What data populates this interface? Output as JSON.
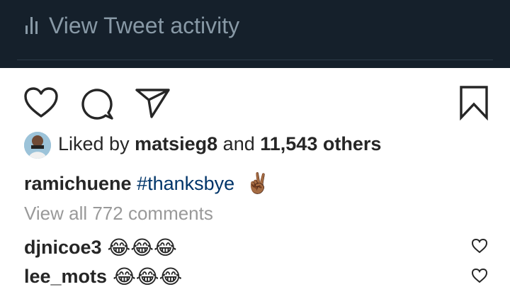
{
  "tweet_activity": {
    "label": "View Tweet activity",
    "icon": "bar-chart-icon"
  },
  "actions": {
    "like_icon": "heart-icon",
    "comment_icon": "comment-bubble-icon",
    "share_icon": "send-arrow-icon",
    "save_icon": "bookmark-icon"
  },
  "likes": {
    "prefix": "Liked by",
    "user": "matsieg8",
    "conjunction": "and",
    "others": "11,543 others"
  },
  "caption": {
    "username": "ramichuene",
    "hashtag": "#thanksbye",
    "emoji": "✌🏾"
  },
  "view_all_comments": "View all 772 comments",
  "comments": [
    {
      "username": "djnicoe3",
      "text": "😂😂😂"
    },
    {
      "username": "lee_mots",
      "text": "😂😂😂"
    }
  ],
  "colors": {
    "tweet_bar_bg": "#15202b",
    "tweet_bar_text": "#8899a6",
    "text": "#262626",
    "hashtag": "#003569",
    "muted": "#999999"
  }
}
